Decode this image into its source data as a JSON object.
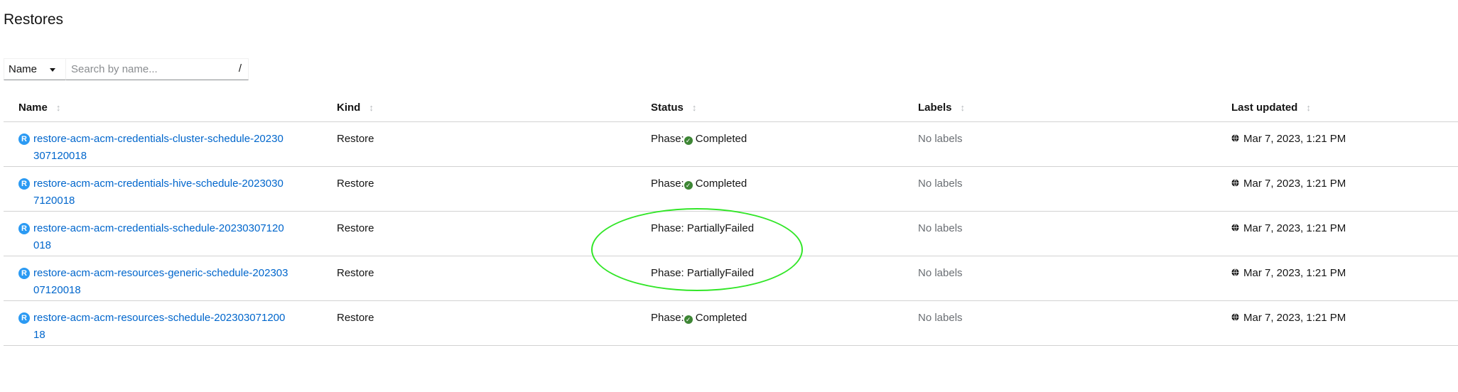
{
  "page": {
    "title": "Restores"
  },
  "filter": {
    "selected": "Name",
    "placeholder": "Search by name...",
    "shortcut_hint": "/"
  },
  "table": {
    "columns": [
      "Name",
      "Kind",
      "Status",
      "Labels",
      "Last updated"
    ],
    "rows": [
      {
        "badge": "R",
        "name": "restore-acm-acm-credentials-cluster-schedule-20230307120018",
        "kind": "Restore",
        "status_prefix": "Phase:",
        "status": "Completed",
        "status_type": "completed",
        "labels": "No labels",
        "updated": "Mar 7, 2023, 1:21 PM"
      },
      {
        "badge": "R",
        "name": "restore-acm-acm-credentials-hive-schedule-20230307120018",
        "kind": "Restore",
        "status_prefix": "Phase:",
        "status": "Completed",
        "status_type": "completed",
        "labels": "No labels",
        "updated": "Mar 7, 2023, 1:21 PM"
      },
      {
        "badge": "R",
        "name": "restore-acm-acm-credentials-schedule-20230307120018",
        "kind": "Restore",
        "status_prefix": "Phase:",
        "status": "PartiallyFailed",
        "status_type": "partial",
        "labels": "No labels",
        "updated": "Mar 7, 2023, 1:21 PM"
      },
      {
        "badge": "R",
        "name": "restore-acm-acm-resources-generic-schedule-20230307120018",
        "kind": "Restore",
        "status_prefix": "Phase:",
        "status": "PartiallyFailed",
        "status_type": "partial",
        "labels": "No labels",
        "updated": "Mar 7, 2023, 1:21 PM"
      },
      {
        "badge": "R",
        "name": "restore-acm-acm-resources-schedule-20230307120018",
        "kind": "Restore",
        "status_prefix": "Phase:",
        "status": "Completed",
        "status_type": "completed",
        "labels": "No labels",
        "updated": "Mar 7, 2023, 1:21 PM"
      }
    ]
  },
  "colors": {
    "link": "#0066cc",
    "badge": "#2b9af3",
    "success": "#3e8635",
    "annotation": "#32e628"
  },
  "icons": {
    "resource_badge": "restore-badge-icon",
    "status_ok": "check-circle-icon",
    "timestamp": "globe-icon",
    "sort": "sort-icon",
    "dropdown": "caret-down-icon"
  }
}
